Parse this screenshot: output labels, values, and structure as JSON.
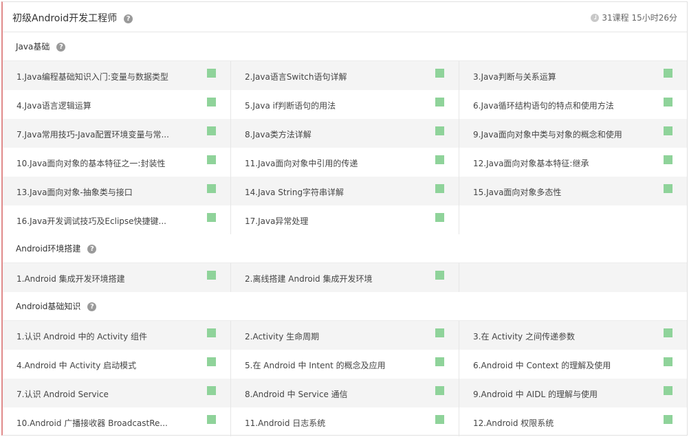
{
  "header": {
    "title": "初级Android开发工程师",
    "meta": "31课程 15小时26分",
    "help": "?"
  },
  "sections": [
    {
      "title": "Java基础",
      "rows": [
        [
          "1.Java编程基础知识入门:变量与数据类型",
          "2.Java语言Switch语句详解",
          "3.Java判断与关系运算"
        ],
        [
          "4.Java语言逻辑运算",
          "5.Java if判断语句的用法",
          "6.Java循环结构语句的特点和使用方法"
        ],
        [
          "7.Java常用技巧-Java配置环境变量与常...",
          "8.Java类方法详解",
          "9.Java面向对象中类与对象的概念和使用"
        ],
        [
          "10.Java面向对象的基本特征之一:封装性",
          "11.Java面向对象中引用的传递",
          "12.Java面向对象基本特征:继承"
        ],
        [
          "13.Java面向对象-抽象类与接口",
          "14.Java String字符串详解",
          "15.Java面向对象多态性"
        ],
        [
          "16.Java开发调试技巧及Eclipse快捷键...",
          "17.Java异常处理",
          ""
        ]
      ]
    },
    {
      "title": "Android环境搭建",
      "rows": [
        [
          "1.Android 集成开发环境搭建",
          "2.离线搭建 Android 集成开发环境",
          ""
        ]
      ]
    },
    {
      "title": "Android基础知识",
      "rows": [
        [
          "1.认识 Android 中的 Activity 组件",
          "2.Activity 生命周期",
          "3.在 Activity 之间传递参数"
        ],
        [
          "4.Android 中 Activity 启动模式",
          "5.在 Android 中 Intent 的概念及应用",
          "6.Android 中 Context 的理解及使用"
        ],
        [
          "7.认识 Android Service",
          "8.Android 中 Service 通信",
          "9.Android 中 AIDL 的理解与使用"
        ],
        [
          "10.Android 广播接收器 BroadcastRe...",
          "11.Android 日志系统",
          "12.Android 权限系统"
        ]
      ]
    }
  ]
}
